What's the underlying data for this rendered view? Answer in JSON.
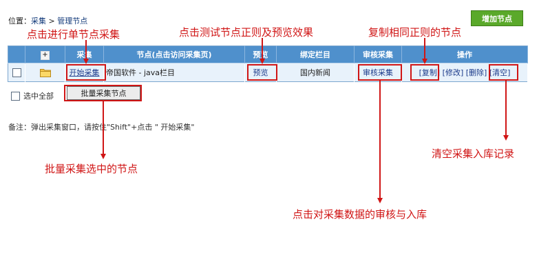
{
  "breadcrumb": {
    "prefix": "位置：",
    "item1": "采集",
    "sep": " > ",
    "item2": "管理节点"
  },
  "add_button_label": "增加节点",
  "table": {
    "headers": {
      "expand": "+",
      "collect": "采集",
      "node": "节点(点击访问采集页)",
      "preview": "预览",
      "category": "绑定栏目",
      "review": "审核采集",
      "ops": "操作"
    },
    "row": {
      "collect_link": "开始采集",
      "node_name": "帝国软件 - java栏目",
      "preview_link": "预览",
      "category": "国内新闻",
      "review_link": "审核采集",
      "op_copy": "[复制]",
      "op_edit": "[修改]",
      "op_delete": "[删除]",
      "op_clear": "[清空]"
    }
  },
  "select_all_label": "选中全部",
  "batch_button_label": "批量采集节点",
  "remark": "备注：弹出采集窗口，请按住\"Shift\"+点击 \" 开始采集\"",
  "annotations": {
    "single_collect": "点击进行单节点采集",
    "test_preview": "点击测试节点正则及预览效果",
    "copy_rule": "复制相同正则的节点",
    "clear_records": "清空采集入库记录",
    "batch_selected": "批量采集选中的节点",
    "review_import": "点击对采集数据的审核与入库"
  }
}
